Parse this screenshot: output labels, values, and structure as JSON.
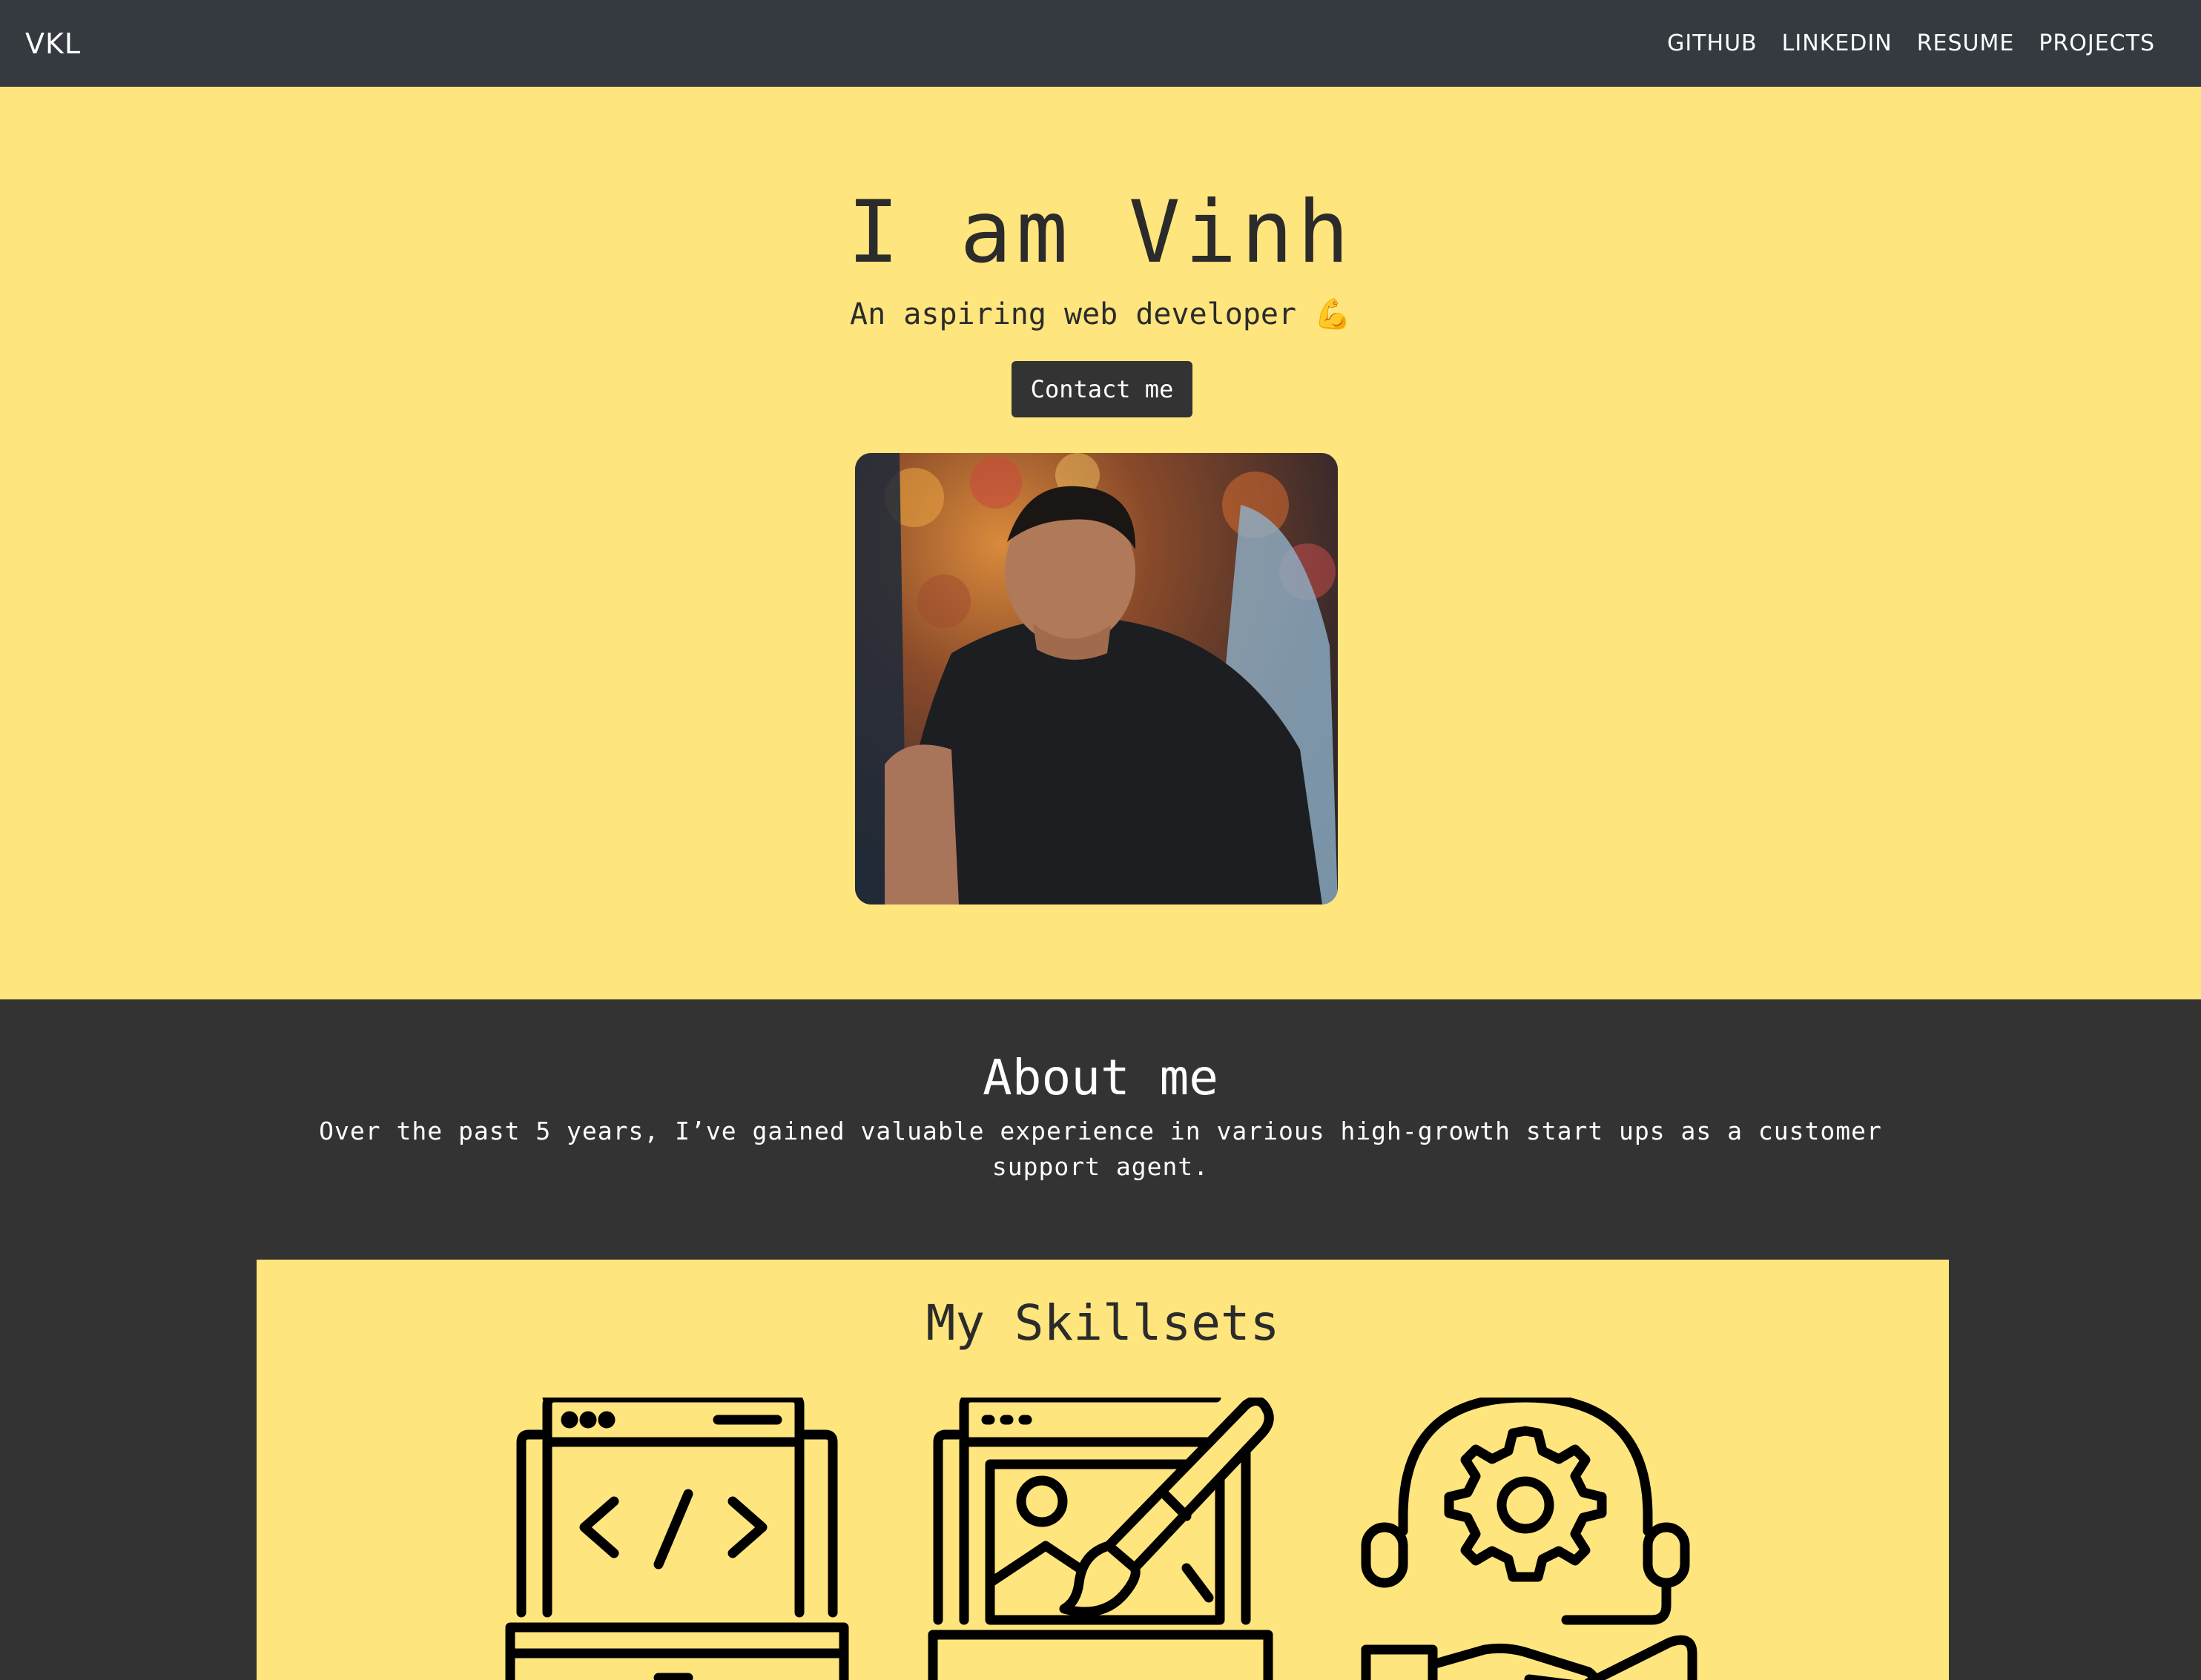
{
  "nav": {
    "brand": "VKL",
    "links": [
      "GITHUB",
      "LINKEDIN",
      "RESUME",
      "PROJECTS"
    ]
  },
  "hero": {
    "title": "I am Vinh",
    "subtitle": "An aspiring web developer 💪",
    "contact_label": "Contact me"
  },
  "about": {
    "title": "About me",
    "text": "Over the past 5 years, I’ve gained valuable experience in various high-growth start ups as a customer support agent."
  },
  "skills": {
    "title": "My Skillsets",
    "icons": [
      "code-laptop-icon",
      "design-laptop-icon",
      "support-headset-icon"
    ]
  },
  "colors": {
    "navbar": "#343a40",
    "accent_yellow": "#ffe57d",
    "dark_section": "#333333",
    "button": "#333333"
  }
}
